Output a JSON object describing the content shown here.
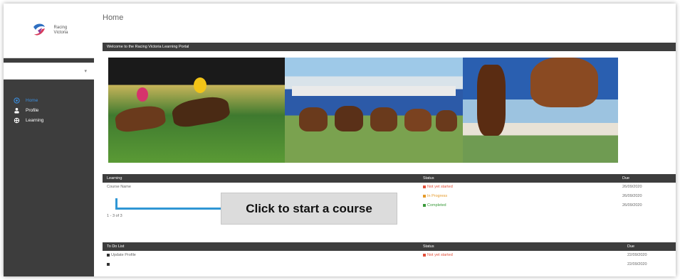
{
  "sidebar": {
    "logo_text": [
      "Racing",
      "Victoria"
    ],
    "selector_value": "",
    "nav": [
      {
        "label": "Home",
        "icon": "home-icon",
        "active": true
      },
      {
        "label": "Profile",
        "icon": "user-icon",
        "active": false
      },
      {
        "label": "Learning",
        "icon": "learning-icon",
        "active": false
      }
    ]
  },
  "page": {
    "title": "Home",
    "welcome": "Welcome to the Racing Victoria Learning Portal"
  },
  "learning_table": {
    "headers": [
      "Learning",
      "Status",
      "Due"
    ],
    "rows": [
      {
        "name": "Course Name",
        "status": "Not yet started",
        "status_color": "#e2513b",
        "due": "26/09/2020"
      },
      {
        "name": "",
        "status": "In Progress",
        "status_color": "#e59a2a",
        "due": "26/09/2020"
      },
      {
        "name": "",
        "status": "Completed",
        "status_color": "#3a9a3a",
        "due": "26/09/2020"
      }
    ],
    "pagination": "1 - 3 of 3"
  },
  "todo_table": {
    "headers": [
      "To Do List",
      "Status",
      "Due"
    ],
    "rows": [
      {
        "name": "Update Profile",
        "status": "Not yet started",
        "status_color": "#e2513b",
        "due": "22/09/2020"
      },
      {
        "name": "",
        "status": "",
        "status_color": "",
        "due": "22/09/2020"
      }
    ]
  },
  "callout": {
    "text": "Click to start a course"
  },
  "colors": {
    "accent": "#2f96d4",
    "bar": "#3d3d3d"
  }
}
